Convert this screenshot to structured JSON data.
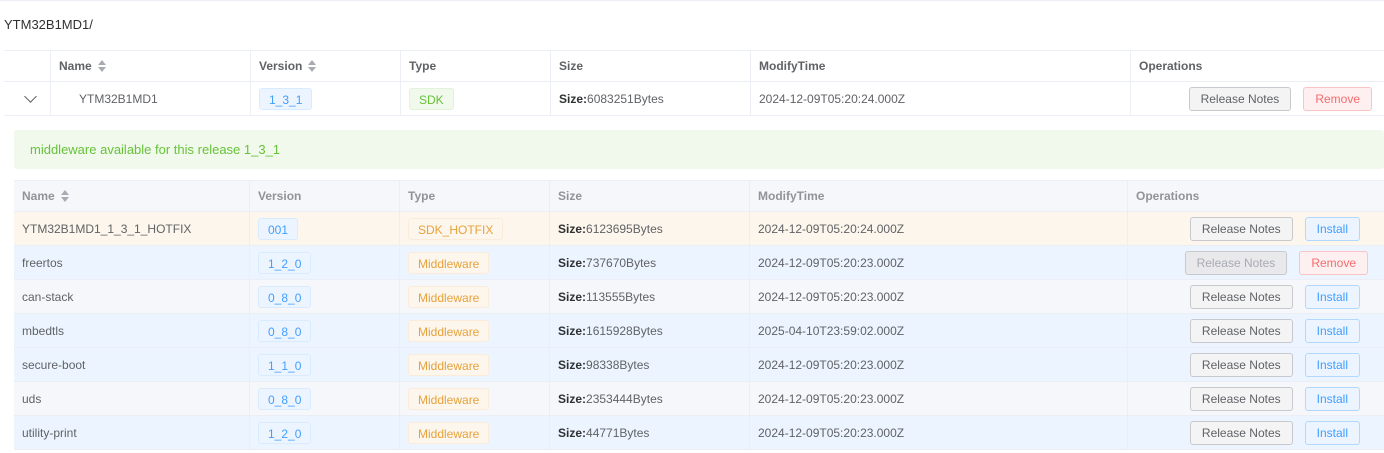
{
  "path": "YTM32B1MD1/",
  "outer_table": {
    "headers": {
      "name": "Name",
      "version": "Version",
      "type": "Type",
      "size": "Size",
      "modify": "ModifyTime",
      "ops": "Operations"
    },
    "row": {
      "name": "YTM32B1MD1",
      "version": "1_3_1",
      "type": "SDK",
      "size_label": "Size:",
      "size_value": "6083251Bytes",
      "modify": "2024-12-09T05:20:24.000Z",
      "btn_release_notes": "Release Notes",
      "btn_remove": "Remove"
    }
  },
  "banner": "middleware available for this release 1_3_1",
  "inner_table": {
    "headers": {
      "name": "Name",
      "version": "Version",
      "type": "Type",
      "size": "Size",
      "modify": "ModifyTime",
      "ops": "Operations"
    },
    "rows": [
      {
        "name": "YTM32B1MD1_1_3_1_HOTFIX",
        "version": "001",
        "type": "SDK_HOTFIX",
        "size_label": "Size:",
        "size_value": "6123695Bytes",
        "modify": "2024-12-09T05:20:24.000Z",
        "btn1": "Release Notes",
        "btn2": "Install"
      },
      {
        "name": "freertos",
        "version": "1_2_0",
        "type": "Middleware",
        "size_label": "Size:",
        "size_value": "737670Bytes",
        "modify": "2024-12-09T05:20:23.000Z",
        "btn1": "Release Notes",
        "btn2": "Remove"
      },
      {
        "name": "can-stack",
        "version": "0_8_0",
        "type": "Middleware",
        "size_label": "Size:",
        "size_value": "113555Bytes",
        "modify": "2024-12-09T05:20:23.000Z",
        "btn1": "Release Notes",
        "btn2": "Install"
      },
      {
        "name": "mbedtls",
        "version": "0_8_0",
        "type": "Middleware",
        "size_label": "Size:",
        "size_value": "1615928Bytes",
        "modify": "2025-04-10T23:59:02.000Z",
        "btn1": "Release Notes",
        "btn2": "Install"
      },
      {
        "name": "secure-boot",
        "version": "1_1_0",
        "type": "Middleware",
        "size_label": "Size:",
        "size_value": "98338Bytes",
        "modify": "2024-12-09T05:20:23.000Z",
        "btn1": "Release Notes",
        "btn2": "Install"
      },
      {
        "name": "uds",
        "version": "0_8_0",
        "type": "Middleware",
        "size_label": "Size:",
        "size_value": "2353444Bytes",
        "modify": "2024-12-09T05:20:23.000Z",
        "btn1": "Release Notes",
        "btn2": "Install"
      },
      {
        "name": "utility-print",
        "version": "1_2_0",
        "type": "Middleware",
        "size_label": "Size:",
        "size_value": "44771Bytes",
        "modify": "2024-12-09T05:20:23.000Z",
        "btn1": "Release Notes",
        "btn2": "Install"
      }
    ]
  },
  "colors": {
    "hotfix_row_bg": "#fdf6ec",
    "installed_row_bg": "#ecf5ff",
    "alt_row_bg": "#f5f7fa",
    "banner_bg": "#f0f9eb",
    "accent": "#409eff"
  },
  "icons": {
    "expand": "chevron-down-icon",
    "sort": "sort-caret-icon"
  }
}
